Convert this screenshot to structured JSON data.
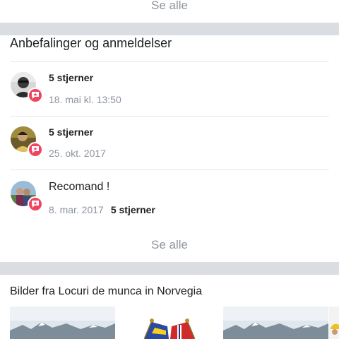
{
  "top": {
    "see_all": "Se alle"
  },
  "reviews_section": {
    "title": "Anbefalinger og anmeldelser",
    "see_all": "Se alle",
    "items": [
      {
        "rating": "5 stjerner",
        "date": "18. mai kl. 13:50",
        "avatar_icon": "person-photo",
        "badge_icon": "star-speech-bubble-icon"
      },
      {
        "rating": "5 stjerner",
        "date": "25. okt. 2017",
        "avatar_icon": "person-photo",
        "badge_icon": "star-speech-bubble-icon"
      },
      {
        "text": "Recomand !",
        "date": "8. mar. 2017",
        "rating": "5 stjerner",
        "avatar_icon": "couple-photo",
        "badge_icon": "star-speech-bubble-icon"
      }
    ]
  },
  "photos_section": {
    "title": "Bilder fra Locuri de munca in Norvegia",
    "photos": [
      "mountain-landscape",
      "crossed-flags-pin",
      "mountain-landscape"
    ]
  },
  "colors": {
    "badge": "#f3425f",
    "divider": "#dadde1",
    "muted_text": "#8d949e"
  }
}
